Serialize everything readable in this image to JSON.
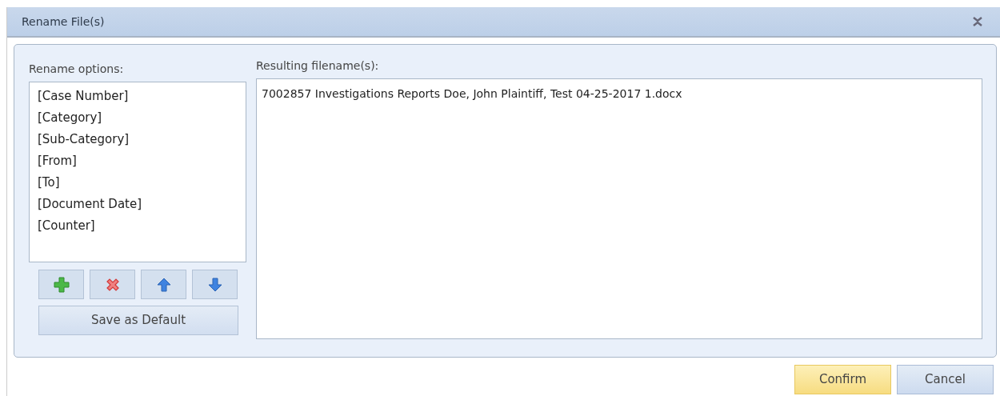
{
  "window": {
    "title": "Rename File(s)"
  },
  "options": {
    "label": "Rename options:",
    "items": [
      {
        "text": "[Case Number]"
      },
      {
        "text": "[Category]"
      },
      {
        "text": "[Sub-Category]"
      },
      {
        "text": "[From]"
      },
      {
        "text": "[To]"
      },
      {
        "text": "[Document Date]"
      },
      {
        "text": "[Counter]"
      }
    ],
    "tools": [
      {
        "kind": "add"
      },
      {
        "kind": "remove"
      },
      {
        "kind": "up"
      },
      {
        "kind": "down"
      }
    ],
    "save_button": "Save as Default"
  },
  "result": {
    "label": "Resulting filename(s):",
    "value": "7002857 Investigations Reports Doe, John Plaintiff, Test 04-25-2017 1.docx"
  },
  "buttons": [
    {
      "label": "Confirm",
      "kind": "primary"
    },
    {
      "label": "Cancel",
      "kind": "secondary"
    }
  ]
}
